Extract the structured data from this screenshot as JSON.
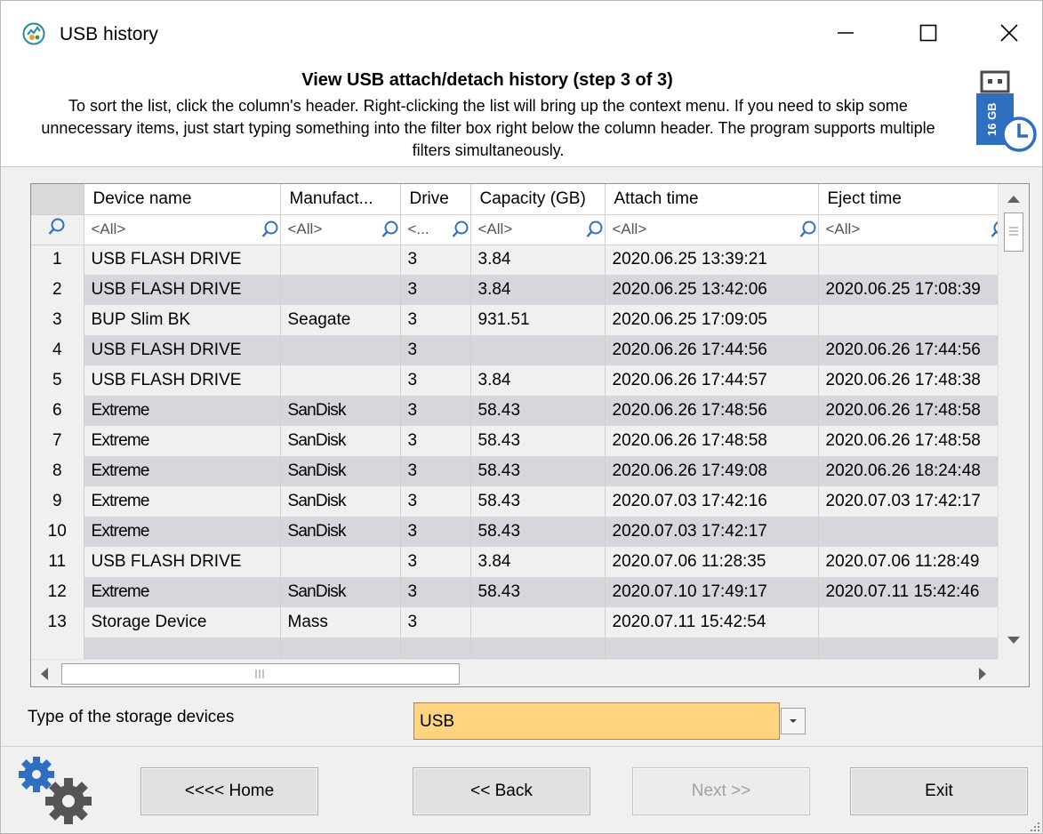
{
  "window": {
    "title": "USB history",
    "icons": {
      "app": "usb-history-app-icon",
      "minimize": "minimize-icon",
      "maximize": "maximize-icon",
      "close": "close-icon"
    }
  },
  "header": {
    "title": "View USB attach/detach history (step 3 of 3)",
    "description": "To sort the list, click the column's header. Right-clicking the list will bring up the context menu. If you need to skip some unnecessary items, just start typing something into the filter box right below the column header. The program supports multiple filters simultaneously.",
    "icon": "usb-drive-clock-icon",
    "usb_label": "16 GB"
  },
  "grid": {
    "columns": [
      "Device name",
      "Manufact...",
      "Drive",
      "Capacity (GB)",
      "Attach time",
      "Eject time"
    ],
    "filters": [
      "<All>",
      "<All>",
      "<...",
      "<All>",
      "<All>",
      "<All>"
    ],
    "rows": [
      {
        "n": "1",
        "device": "USB FLASH DRIVE",
        "manufacturer": "",
        "drive": "3",
        "capacity": "3.84",
        "attach": "2020.06.25 13:39:21",
        "eject": ""
      },
      {
        "n": "2",
        "device": "USB FLASH DRIVE",
        "manufacturer": "",
        "drive": "3",
        "capacity": "3.84",
        "attach": "2020.06.25 13:42:06",
        "eject": "2020.06.25 17:08:39"
      },
      {
        "n": "3",
        "device": "BUP Slim BK",
        "manufacturer": "Seagate",
        "drive": "3",
        "capacity": "931.51",
        "attach": "2020.06.25 17:09:05",
        "eject": ""
      },
      {
        "n": "4",
        "device": "USB FLASH DRIVE",
        "manufacturer": "",
        "drive": "3",
        "capacity": "",
        "attach": "2020.06.26 17:44:56",
        "eject": "2020.06.26 17:44:56"
      },
      {
        "n": "5",
        "device": "USB FLASH DRIVE",
        "manufacturer": "",
        "drive": "3",
        "capacity": "3.84",
        "attach": "2020.06.26 17:44:57",
        "eject": "2020.06.26 17:48:38"
      },
      {
        "n": "6",
        "device": "Extreme",
        "manufacturer": "SanDisk",
        "drive": "3",
        "capacity": "58.43",
        "attach": "2020.06.26 17:48:56",
        "eject": "2020.06.26 17:48:58"
      },
      {
        "n": "7",
        "device": "Extreme",
        "manufacturer": "SanDisk",
        "drive": "3",
        "capacity": "58.43",
        "attach": "2020.06.26 17:48:58",
        "eject": "2020.06.26 17:48:58"
      },
      {
        "n": "8",
        "device": "Extreme",
        "manufacturer": "SanDisk",
        "drive": "3",
        "capacity": "58.43",
        "attach": "2020.06.26 17:49:08",
        "eject": "2020.06.26 18:24:48"
      },
      {
        "n": "9",
        "device": "Extreme",
        "manufacturer": "SanDisk",
        "drive": "3",
        "capacity": "58.43",
        "attach": "2020.07.03 17:42:16",
        "eject": "2020.07.03 17:42:17"
      },
      {
        "n": "10",
        "device": "Extreme",
        "manufacturer": "SanDisk",
        "drive": "3",
        "capacity": "58.43",
        "attach": "2020.07.03 17:42:17",
        "eject": ""
      },
      {
        "n": "11",
        "device": "USB FLASH DRIVE",
        "manufacturer": "",
        "drive": "3",
        "capacity": "3.84",
        "attach": "2020.07.06 11:28:35",
        "eject": "2020.07.06 11:28:49"
      },
      {
        "n": "12",
        "device": "Extreme",
        "manufacturer": "SanDisk",
        "drive": "3",
        "capacity": "58.43",
        "attach": "2020.07.10 17:49:17",
        "eject": "2020.07.11 15:42:46"
      },
      {
        "n": "13",
        "device": "Storage Device",
        "manufacturer": "Mass",
        "drive": "3",
        "capacity": "",
        "attach": "2020.07.11 15:42:54",
        "eject": ""
      }
    ]
  },
  "storage_type": {
    "label": "Type of the storage devices",
    "value": "USB",
    "highlight_color": "#ffd47f"
  },
  "buttons": {
    "home": "<<<< Home",
    "back": "<< Back",
    "next": "Next >>",
    "exit": "Exit"
  },
  "colors": {
    "row_alt": "#d6d6dd",
    "window_bg": "#f0f0f0"
  }
}
